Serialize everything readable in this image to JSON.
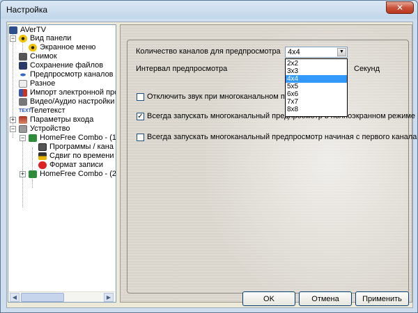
{
  "window": {
    "title": "Настройка",
    "close_label": "✕"
  },
  "tree": {
    "items": [
      {
        "label": "AVerTV",
        "icon": "avertv-logo-icon",
        "color": "#2c4d8e"
      },
      {
        "label": "Вид панели",
        "icon": "radiation-icon",
        "color": "#e8b400"
      },
      {
        "label": "Экранное меню",
        "icon": "radiation-icon",
        "color": "#e8b400"
      },
      {
        "label": "Снимок",
        "icon": "camera-icon",
        "color": "#555555"
      },
      {
        "label": "Сохранение файлов",
        "icon": "floppy-icon",
        "color": "#2a3a6a"
      },
      {
        "label": "Предпросмотр каналов",
        "icon": "eye-icon",
        "color": "#3366cc"
      },
      {
        "label": "Разное",
        "icon": "document-icon",
        "color": "#d8d8d8"
      },
      {
        "label": "Импорт электронной прог",
        "icon": "import-icon",
        "color": "#3355aa"
      },
      {
        "label": "Видео/Аудио настройки",
        "icon": "wrench-icon",
        "color": "#777777"
      },
      {
        "label": "Телетекст",
        "icon": "teletext-icon",
        "color": "#2255cc"
      },
      {
        "label": "Параметры входа",
        "icon": "input-icon",
        "color": "#aa3322"
      },
      {
        "label": "Устройство",
        "icon": "device-icon",
        "color": "#999999"
      },
      {
        "label": "HomeFree Combo - (1) [(",
        "icon": "board-icon",
        "color": "#2e8b3a"
      },
      {
        "label": "Программы / кана",
        "icon": "programs-icon",
        "color": "#555555"
      },
      {
        "label": "Сдвиг по времени",
        "icon": "timeshift-icon",
        "color": "#333333"
      },
      {
        "label": "Формат записи",
        "icon": "record-icon",
        "color": "#dd2222"
      },
      {
        "label": "HomeFree Combo - (2) [(",
        "icon": "board-icon",
        "color": "#2e8b3a"
      }
    ],
    "scroll_left": "◀",
    "scroll_right": "▶"
  },
  "panel": {
    "channels_label": "Количество каналов для предпросмотра",
    "channels_value": "4x4",
    "options": [
      "2x2",
      "3x3",
      "4x4",
      "5x5",
      "6x6",
      "7x7",
      "8x8"
    ],
    "selected_option_index": 2,
    "interval_label": "Интервал предпросмотра",
    "interval_unit": "Секунд",
    "mute_label": "Отключить звук при многоканальном предпросм",
    "mute_checked": false,
    "fullscreen_label": "Всегда запускать многоканальный предпросмотр в полноэкранном режиме",
    "fullscreen_checked": true,
    "first_channel_label": "Всегда запускать многоканальный предпросмотр начиная с первого канала",
    "first_channel_checked": false
  },
  "buttons": {
    "ok": "OK",
    "cancel": "Отмена",
    "apply": "Применить"
  },
  "colors": {
    "accent": "#3399ff",
    "window_frame": "#cfdeee"
  }
}
